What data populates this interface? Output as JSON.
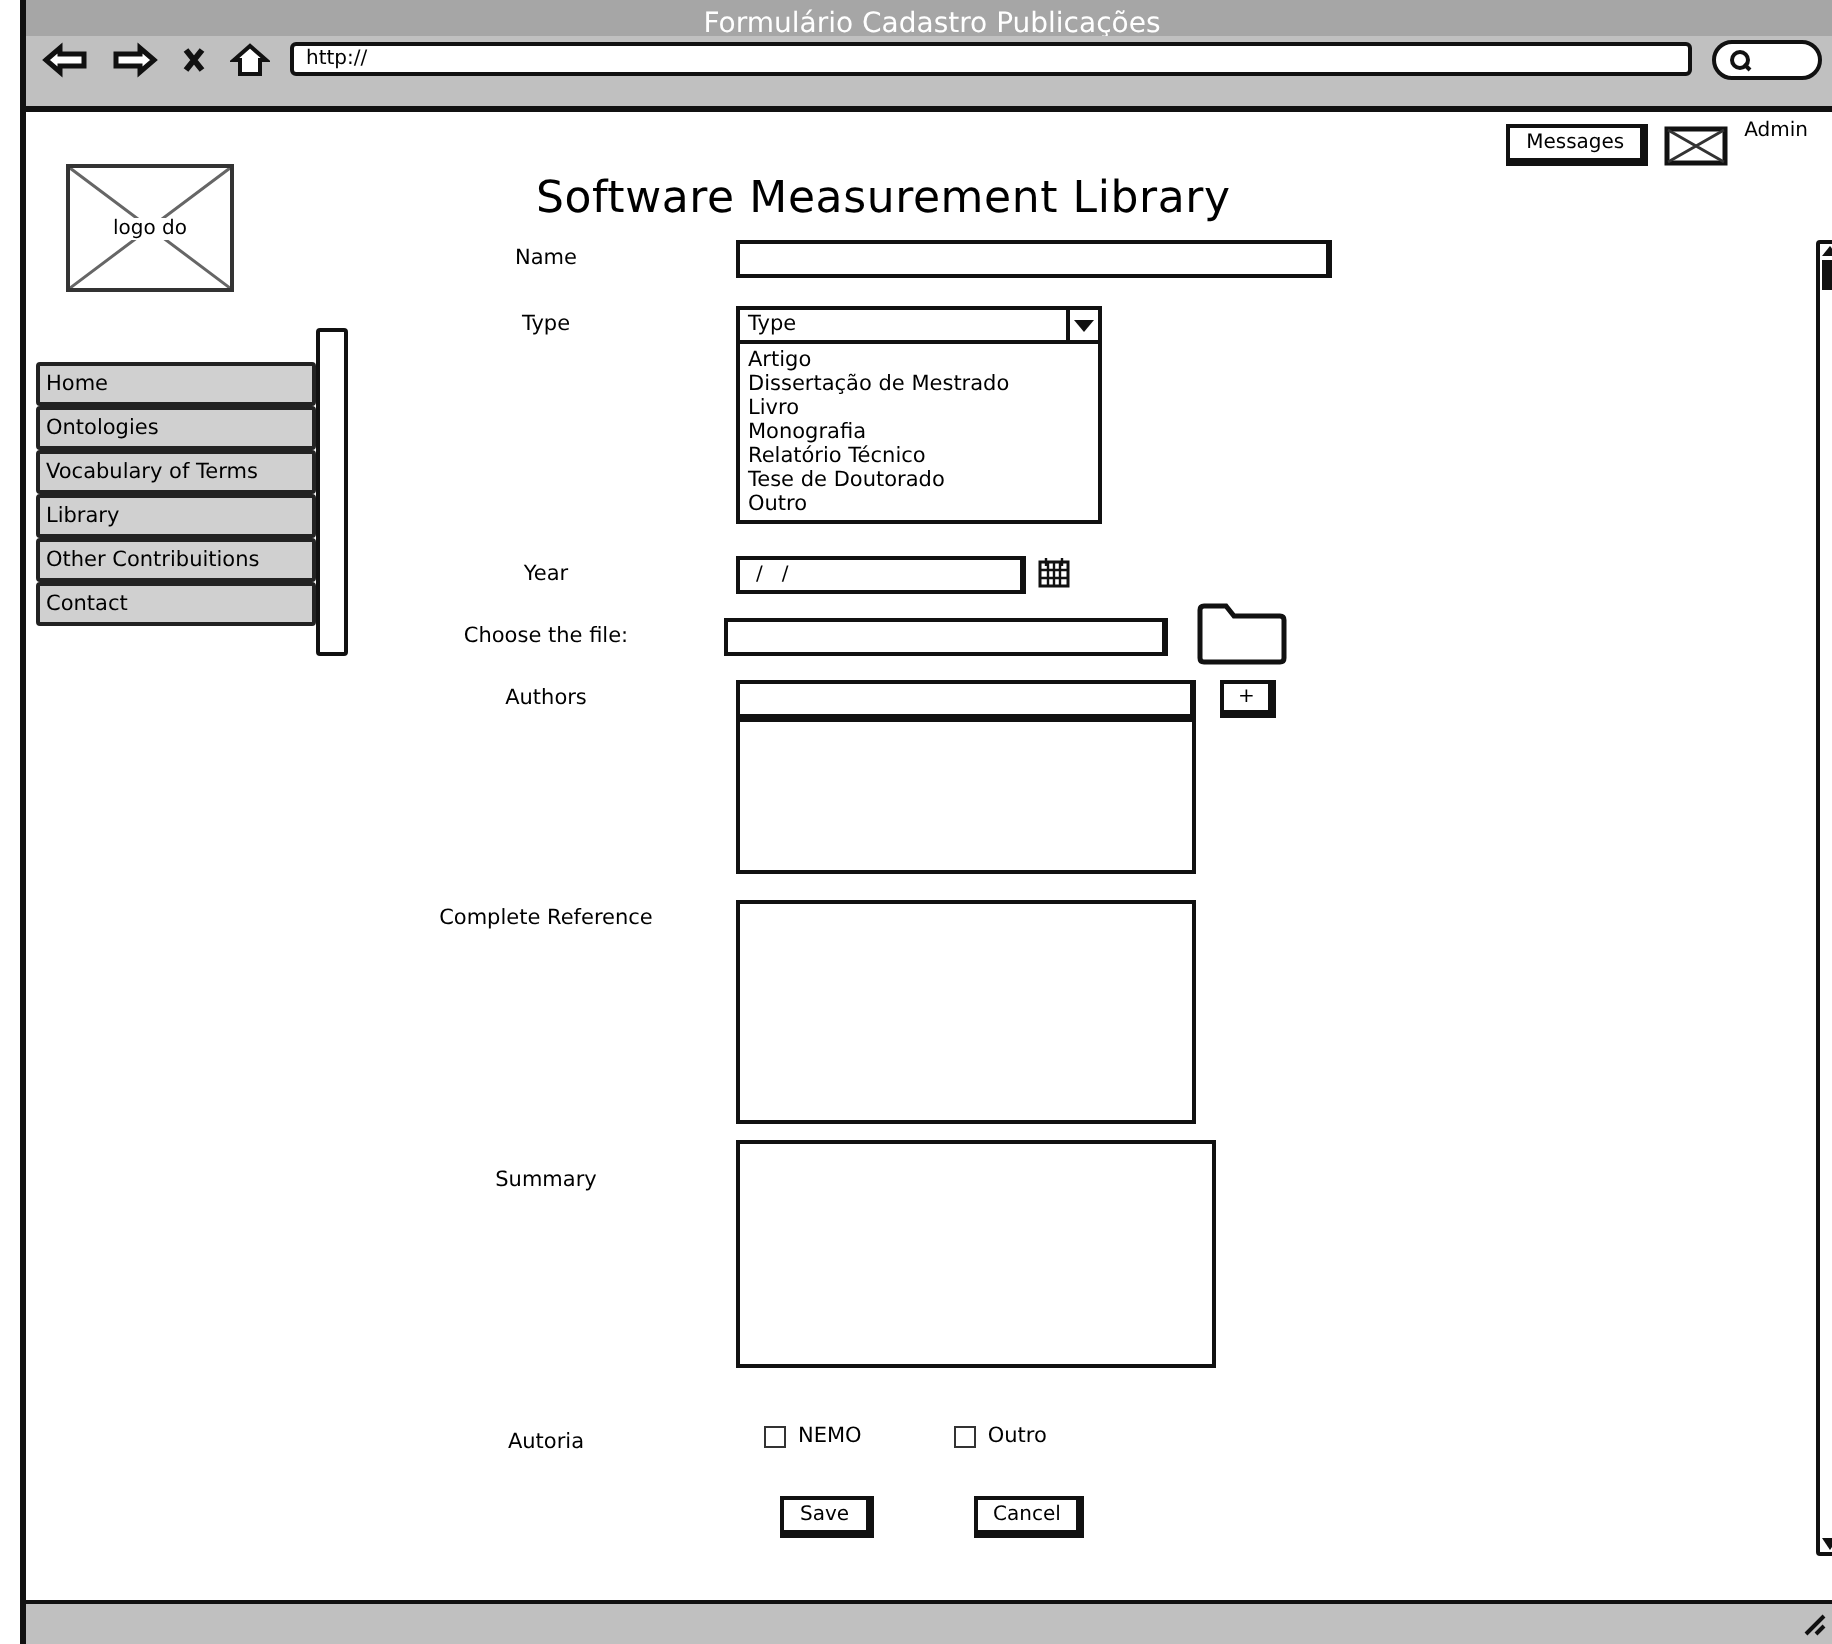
{
  "window": {
    "title": "Formulário Cadastro Publicações"
  },
  "browser": {
    "url": "http://"
  },
  "header": {
    "messages_button": "Messages",
    "user": "Admin"
  },
  "logo": {
    "label": "logo do"
  },
  "nav": [
    {
      "label": "Home"
    },
    {
      "label": "Ontologies"
    },
    {
      "label": "Vocabulary of Terms"
    },
    {
      "label": "Library"
    },
    {
      "label": "Other Contribuitions"
    },
    {
      "label": "Contact"
    }
  ],
  "page_title": "Software Measurement Library",
  "form": {
    "name": {
      "label": "Name"
    },
    "type": {
      "label": "Type",
      "value": "Type",
      "expanded": true,
      "options": [
        "Artigo",
        "Dissertação de Mestrado",
        "Livro",
        "Monografia",
        "Relatório Técnico",
        "Tese de Doutorado",
        "Outro"
      ]
    },
    "year": {
      "label": "Year",
      "value": "/   /"
    },
    "file": {
      "label": "Choose the file:"
    },
    "authors": {
      "label": "Authors",
      "add_button": "+"
    },
    "reference": {
      "label": "Complete Reference"
    },
    "summary": {
      "label": "Summary"
    },
    "authorship": {
      "label": "Autoria",
      "options": [
        {
          "label": "NEMO",
          "checked": false
        },
        {
          "label": "Outro",
          "checked": false
        }
      ]
    }
  },
  "buttons": [
    "Save",
    "Cancel"
  ]
}
